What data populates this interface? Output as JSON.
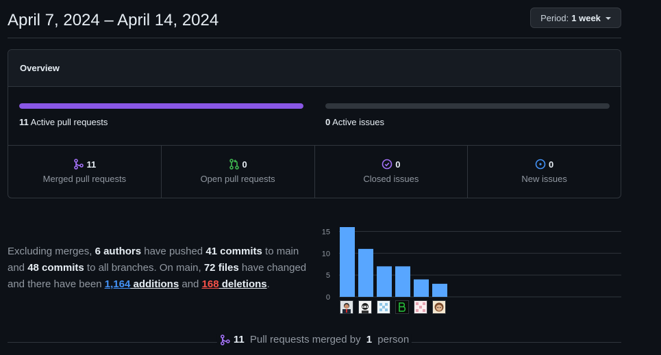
{
  "header": {
    "title": "April 7, 2024 – April 14, 2024",
    "period_prefix": "Period:",
    "period_value": "1 week"
  },
  "overview": {
    "title": "Overview",
    "pr_bar": {
      "count": "11",
      "label": "Active pull requests",
      "fill_fraction": 1.0,
      "color": "#8957e5"
    },
    "issues_bar": {
      "count": "0",
      "label": "Active issues",
      "fill_fraction": 0.0
    },
    "stats": [
      {
        "icon": "git-merge-icon",
        "count": "11",
        "label": "Merged pull requests",
        "color": "#a371f7"
      },
      {
        "icon": "git-pull-request-icon",
        "count": "0",
        "label": "Open pull requests",
        "color": "#3fb950"
      },
      {
        "icon": "issue-closed-icon",
        "count": "0",
        "label": "Closed issues",
        "color": "#a371f7"
      },
      {
        "icon": "issue-opened-icon",
        "count": "0",
        "label": "New issues",
        "color": "#3fb950"
      }
    ]
  },
  "summary": {
    "t1": "Excluding merges, ",
    "authors": "6 authors",
    "t2": " have pushed ",
    "commits_main": "41 commits",
    "t3": " to main and ",
    "commits_all": "48 commits",
    "t4": " to all branches. On main, ",
    "files": "72 files",
    "t5": " have changed and there have been ",
    "additions_num": "1,164",
    "additions_word": " additions",
    "t6": " and ",
    "deletions_num": "168",
    "deletions_word": " deletions",
    "t7": "."
  },
  "chart_data": {
    "type": "bar",
    "categories": [
      "author-1",
      "author-2",
      "author-3",
      "author-4",
      "author-5",
      "author-6"
    ],
    "values": [
      16,
      11,
      7,
      7,
      4,
      3
    ],
    "ylim": [
      0,
      16
    ],
    "yticks": [
      0,
      5,
      10,
      15
    ],
    "grid": true,
    "bar_color": "#58a6ff"
  },
  "footer": {
    "count": "11",
    "t1": " Pull requests merged by ",
    "people": "1",
    "t2": " person"
  }
}
